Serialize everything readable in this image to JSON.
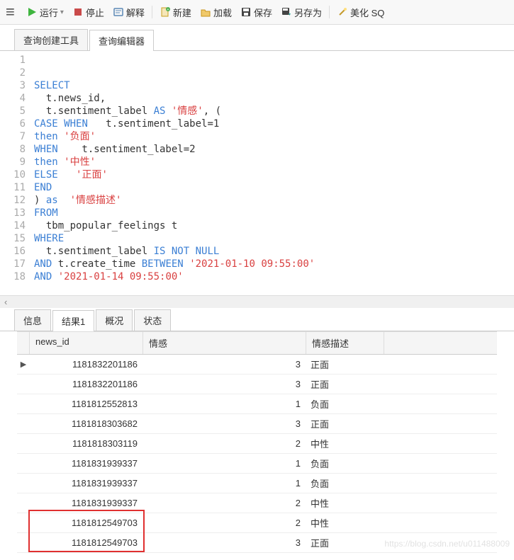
{
  "toolbar": {
    "run": "运行",
    "stop": "停止",
    "explain": "解释",
    "new": "新建",
    "load": "加载",
    "save": "保存",
    "saveas": "另存为",
    "beautify": "美化 SQ"
  },
  "tabs": {
    "query_builder": "查询创建工具",
    "query_editor": "查询编辑器"
  },
  "code": {
    "lines": [
      "",
      "",
      "SELECT",
      "  t.news_id,",
      "  t.sentiment_label AS '情感', (",
      "CASE WHEN   t.sentiment_label=1",
      "then '负面'",
      "WHEN    t.sentiment_label=2",
      "then '中性'",
      "ELSE   '正面'",
      "END",
      ") as  '情感描述'",
      "FROM",
      "  tbm_popular_feelings t",
      "WHERE",
      "  t.sentiment_label IS NOT NULL",
      "AND t.create_time BETWEEN '2021-01-10 09:55:00'",
      "AND '2021-01-14 09:55:00'"
    ]
  },
  "result_tabs": {
    "info": "信息",
    "result1": "结果1",
    "profile": "概况",
    "status": "状态"
  },
  "grid": {
    "headers": {
      "news_id": "news_id",
      "sentiment": "情感",
      "desc": "情感描述"
    },
    "rows": [
      {
        "news_id": "1181832201186",
        "sentiment": "3",
        "desc": "正面",
        "current": true
      },
      {
        "news_id": "1181832201186",
        "sentiment": "3",
        "desc": "正面"
      },
      {
        "news_id": "1181812552813",
        "sentiment": "1",
        "desc": "负面"
      },
      {
        "news_id": "1181818303682",
        "sentiment": "3",
        "desc": "正面"
      },
      {
        "news_id": "1181818303119",
        "sentiment": "2",
        "desc": "中性"
      },
      {
        "news_id": "1181831939337",
        "sentiment": "1",
        "desc": "负面"
      },
      {
        "news_id": "1181831939337",
        "sentiment": "1",
        "desc": "负面"
      },
      {
        "news_id": "1181831939337",
        "sentiment": "2",
        "desc": "中性"
      },
      {
        "news_id": "1181812549703",
        "sentiment": "2",
        "desc": "中性",
        "hl": true
      },
      {
        "news_id": "1181812549703",
        "sentiment": "3",
        "desc": "正面",
        "hl": true
      }
    ]
  },
  "watermark": "https://blog.csdn.net/u011488009",
  "highlight_box": {
    "top_row": 8,
    "rows": 2
  }
}
